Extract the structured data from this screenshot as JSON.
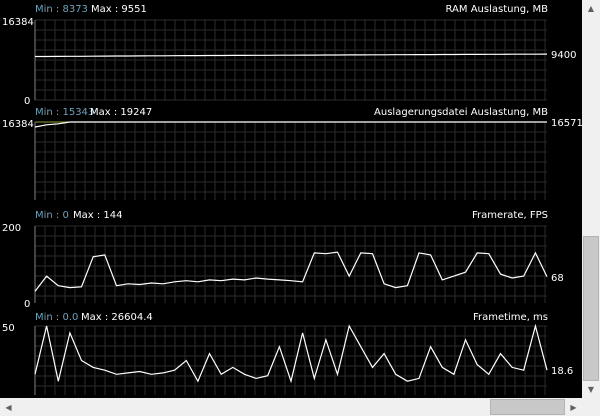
{
  "chart_data": [
    {
      "type": "line",
      "title": "RAM Auslastung, MB",
      "min_label": "Min : 8373",
      "max_label": "Max : 9551",
      "ylim": [
        0,
        16384
      ],
      "ytick_top": "16384",
      "ytick_bottom": "0",
      "current_value": "9400",
      "series": [
        {
          "values": [
            8900,
            8900,
            8920,
            8940,
            8960,
            8980,
            9000,
            9010,
            9020,
            9040,
            9050,
            9060,
            9080,
            9090,
            9100,
            9110,
            9120,
            9130,
            9140,
            9150,
            9160,
            9170,
            9180,
            9190,
            9200,
            9210,
            9220,
            9230,
            9240,
            9250,
            9260,
            9270,
            9280,
            9290,
            9300,
            9310,
            9320,
            9330,
            9340,
            9350,
            9360,
            9370,
            9380,
            9390,
            9400
          ]
        }
      ]
    },
    {
      "type": "line",
      "title": "Auslagerungsdatei Auslastung, MB",
      "min_label": "Min : 15343",
      "max_label": "Max : 19247",
      "ylim": [
        0,
        16384
      ],
      "ytick_top": "16384",
      "ytick_bottom": "",
      "current_value": "16571",
      "series": [
        {
          "values": [
            15343,
            15800,
            16000,
            16384,
            16384,
            16384,
            16384,
            16384,
            16384,
            16384,
            16384,
            16384,
            16384,
            16384,
            16384,
            16384,
            16384,
            16384,
            16384,
            16384,
            16384,
            16384,
            16384,
            16384,
            16384,
            16384,
            16384,
            16384,
            16384,
            16384,
            16384,
            16384,
            16384,
            16384,
            16384,
            16384,
            16384,
            16384,
            16384,
            16384,
            16384,
            16384,
            16384,
            16384,
            16384
          ]
        }
      ]
    },
    {
      "type": "line",
      "title": "Framerate, FPS",
      "min_label": "Min : 0",
      "max_label": "Max : 144",
      "ylim": [
        0,
        200
      ],
      "ytick_top": "200",
      "ytick_bottom": "0",
      "current_value": "68",
      "series": [
        {
          "values": [
            30,
            70,
            45,
            40,
            42,
            120,
            125,
            45,
            50,
            48,
            52,
            50,
            55,
            58,
            55,
            60,
            58,
            62,
            60,
            65,
            62,
            60,
            58,
            55,
            130,
            128,
            132,
            70,
            130,
            128,
            50,
            40,
            45,
            130,
            125,
            60,
            70,
            80,
            130,
            128,
            75,
            65,
            70,
            130,
            68
          ]
        }
      ]
    },
    {
      "type": "line",
      "title": "Frametime, ms",
      "min_label": "Min : 0.0",
      "max_label": "Max : 26604.4",
      "ylim": [
        0,
        50
      ],
      "ytick_top": "50",
      "ytick_bottom": "",
      "current_value": "18.6",
      "series": [
        {
          "values": [
            15,
            50,
            10,
            45,
            25,
            20,
            18,
            15,
            16,
            17,
            15,
            16,
            18,
            25,
            10,
            30,
            15,
            20,
            15,
            12,
            14,
            35,
            10,
            45,
            12,
            40,
            15,
            50,
            35,
            20,
            30,
            15,
            10,
            12,
            35,
            20,
            15,
            40,
            22,
            15,
            30,
            20,
            18,
            50,
            18
          ]
        }
      ]
    }
  ],
  "colors": {
    "background": "#000000",
    "grid": "#2b2b2b",
    "line": "#ffffff",
    "minlabel": "#6fa0b8",
    "text": "#ffffff"
  }
}
